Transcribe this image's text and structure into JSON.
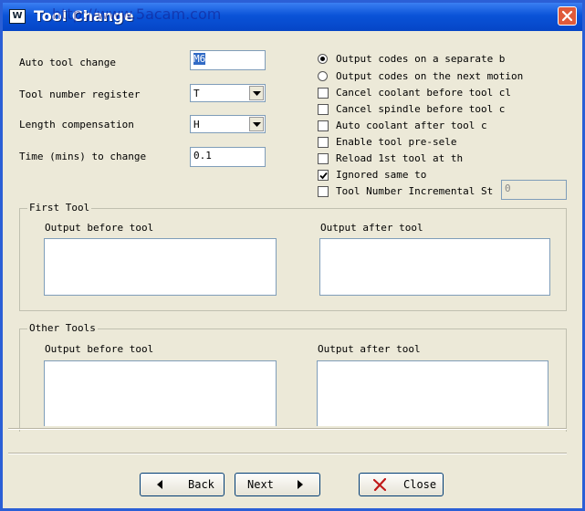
{
  "window": {
    "title": "Tool Change",
    "watermark": "http://www.5acam.com"
  },
  "fields": {
    "auto_tool_change": {
      "label": "Auto tool change",
      "value": "M6"
    },
    "tool_number_register": {
      "label": "Tool number register",
      "value": "T"
    },
    "length_compensation": {
      "label": "Length compensation",
      "value": "H"
    },
    "time_to_change": {
      "label": "Time (mins) to change",
      "value": "0.1"
    }
  },
  "options": {
    "output_separate": {
      "label": "Output codes on a separate b",
      "selected": true
    },
    "output_next_motion": {
      "label": "Output codes on the next motion",
      "selected": false
    },
    "cancel_coolant": {
      "label": "Cancel coolant before tool cl",
      "checked": false
    },
    "cancel_spindle": {
      "label": "Cancel spindle before tool c",
      "checked": false
    },
    "auto_coolant": {
      "label": "Auto coolant after tool c",
      "checked": false
    },
    "enable_preselect": {
      "label": "Enable tool pre-sele",
      "checked": false
    },
    "reload_first_tool": {
      "label": "Reload 1st tool at th",
      "checked": false
    },
    "ignored_same": {
      "label": "Ignored same to",
      "checked": true
    },
    "tool_number_incremental": {
      "label": "Tool Number Incremental St",
      "checked": false,
      "value": "0"
    }
  },
  "first_tool": {
    "title": "First Tool",
    "before_label": "Output before tool",
    "after_label": "Output after tool"
  },
  "other_tools": {
    "title": "Other Tools",
    "before_label": "Output before tool",
    "after_label": "Output after tool"
  },
  "buttons": {
    "back": "Back",
    "next": "Next",
    "close": "Close"
  },
  "colors": {
    "titlebar": "#0a53d8",
    "dialog_bg": "#ece9d8",
    "close_button": "#e05a3a",
    "field_border": "#7f9db9"
  }
}
